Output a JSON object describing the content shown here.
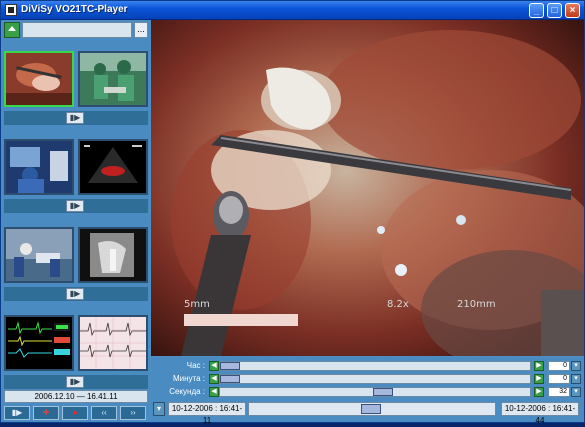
{
  "window": {
    "title": "DiViSy VO21TC-Player",
    "controls": {
      "minimize": "_",
      "maximize": "□",
      "close": "×"
    }
  },
  "sidebar": {
    "more_label": "...",
    "date_range": "2006.12.10 — 16.41.11",
    "groups": [
      {
        "play_label": "▮▶"
      },
      {
        "play_label": "▮▶"
      },
      {
        "play_label": "▮▶"
      },
      {
        "play_label": "▮▶"
      }
    ],
    "transport": [
      {
        "label": "▮▶",
        "name": "play-pause-button"
      },
      {
        "label": "✚",
        "name": "marker-button"
      },
      {
        "label": "●",
        "name": "record-button"
      },
      {
        "label": "‹‹",
        "name": "rewind-button"
      },
      {
        "label": "››",
        "name": "fast-forward-button"
      }
    ]
  },
  "video": {
    "overlay_scale": "5mm",
    "overlay_zoom": "8.2x",
    "overlay_distance": "210mm"
  },
  "timeline": {
    "hour": {
      "label": "Час :",
      "value": "0",
      "position": 0
    },
    "minute": {
      "label": "Минута :",
      "value": "0",
      "position": 0
    },
    "second": {
      "label": "Секунда :",
      "value": "32",
      "position": 0.53
    },
    "start_time": "10-12-2006 : 16:41-11",
    "end_time": "10-12-2006 : 16:41-44",
    "playback_position": 0.5
  },
  "colors": {
    "accent": "#37d84a",
    "titlebar": "#0a56d8",
    "panel": "#4a8cc2"
  }
}
